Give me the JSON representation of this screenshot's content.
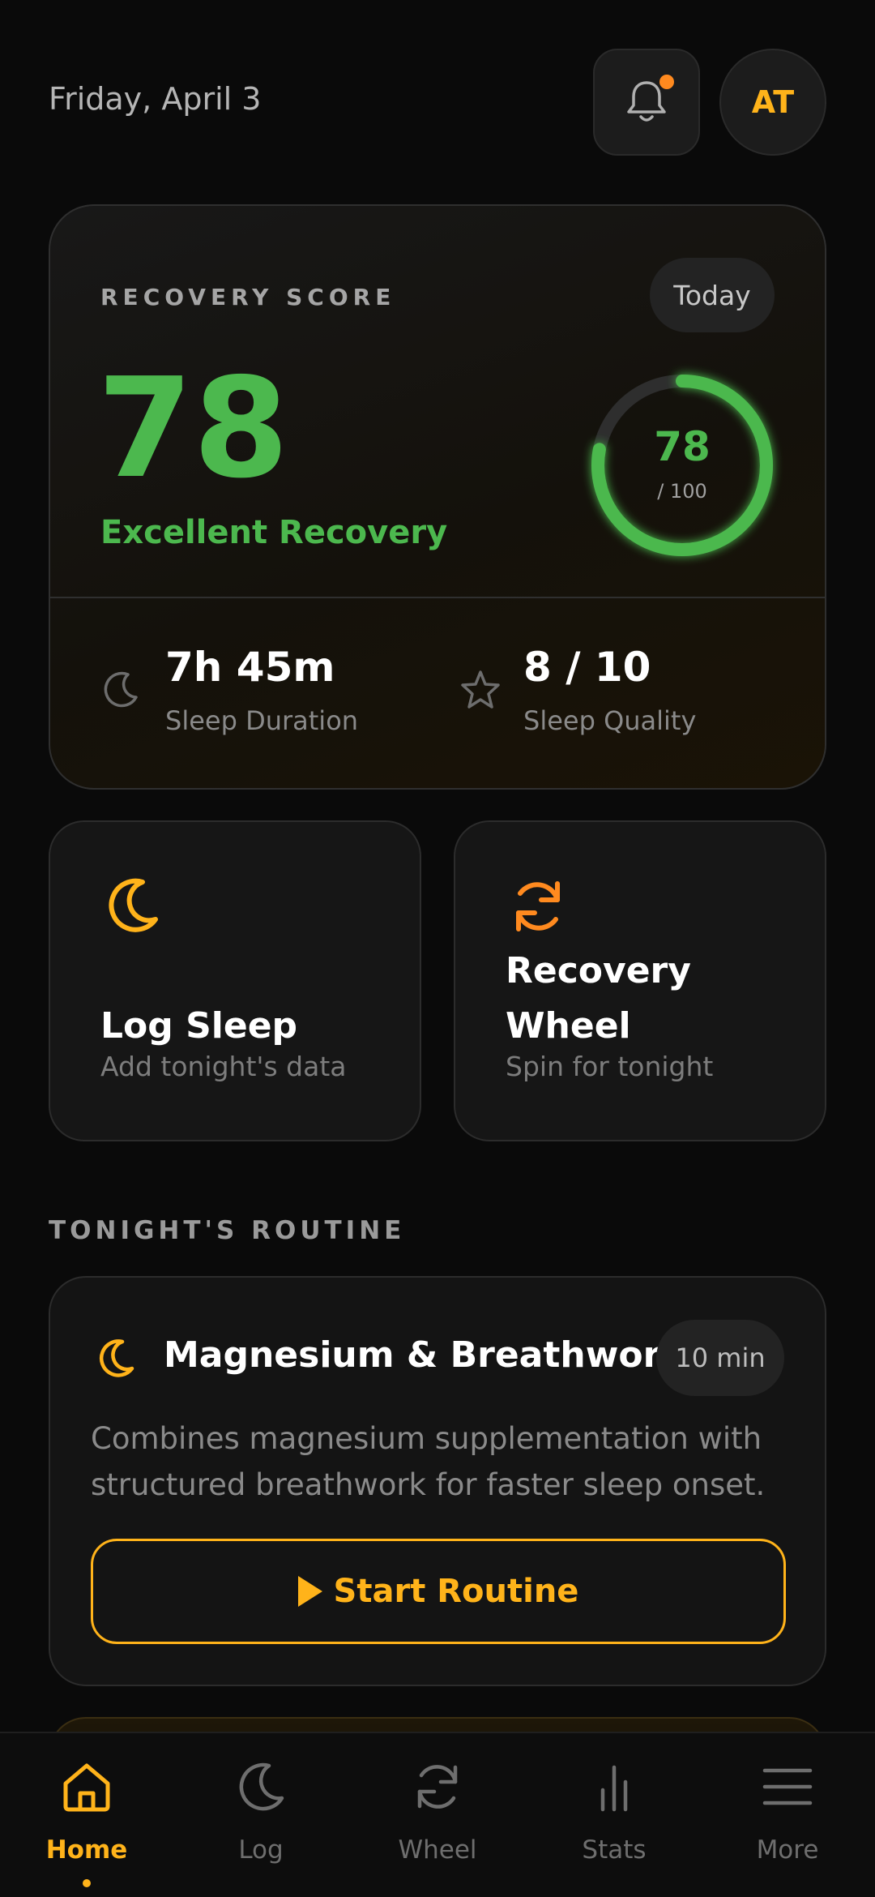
{
  "header": {
    "date": "Friday, April 3",
    "avatar_initials": "AT",
    "notification_icon": "bell-icon"
  },
  "recovery": {
    "label": "RECOVERY SCORE",
    "period": "Today",
    "score": "78",
    "status": "Excellent Recovery",
    "ring_value": "78",
    "ring_max": "/ 100",
    "ring_fraction": 0.78,
    "stats": {
      "sleep_duration_value": "7h 45m",
      "sleep_duration_label": "Sleep Duration",
      "sleep_quality_value": "8 / 10",
      "sleep_quality_label": "Sleep Quality"
    }
  },
  "actions": {
    "log_sleep_title": "Log Sleep",
    "log_sleep_sub": "Add tonight's data",
    "wheel_title_line1": "Recovery",
    "wheel_title_line2": "Wheel",
    "wheel_sub": "Spin for tonight"
  },
  "routine": {
    "section_title": "TONIGHT'S ROUTINE",
    "title": "Magnesium & Breathwork",
    "duration": "10 min",
    "description": "Combines magnesium supplementation with structured breathwork for faster sleep onset.",
    "start_label": "Start Routine"
  },
  "nav": {
    "items": [
      {
        "label": "Home",
        "icon": "home-icon",
        "active": true
      },
      {
        "label": "Log",
        "icon": "moon-icon",
        "active": false
      },
      {
        "label": "Wheel",
        "icon": "refresh-icon",
        "active": false
      },
      {
        "label": "Stats",
        "icon": "bar-chart-icon",
        "active": false
      },
      {
        "label": "More",
        "icon": "menu-icon",
        "active": false
      }
    ]
  },
  "colors": {
    "accent": "#ffb31a",
    "success": "#4cb84e",
    "background": "#0a0a0a",
    "notification_dot": "#ff8a1f"
  }
}
